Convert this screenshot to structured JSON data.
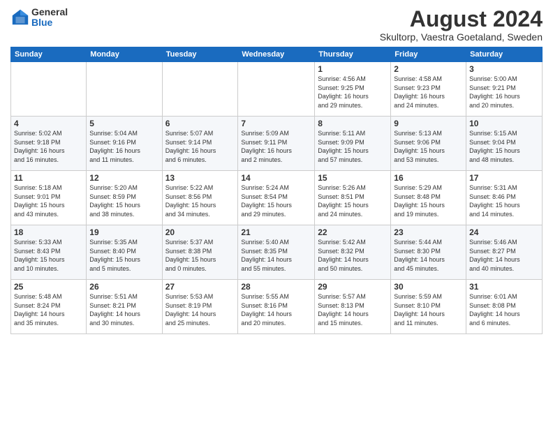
{
  "logo": {
    "general": "General",
    "blue": "Blue"
  },
  "title": {
    "month": "August 2024",
    "location": "Skultorp, Vaestra Goetaland, Sweden"
  },
  "headers": [
    "Sunday",
    "Monday",
    "Tuesday",
    "Wednesday",
    "Thursday",
    "Friday",
    "Saturday"
  ],
  "weeks": [
    [
      {
        "day": "",
        "info": ""
      },
      {
        "day": "",
        "info": ""
      },
      {
        "day": "",
        "info": ""
      },
      {
        "day": "",
        "info": ""
      },
      {
        "day": "1",
        "info": "Sunrise: 4:56 AM\nSunset: 9:25 PM\nDaylight: 16 hours\nand 29 minutes."
      },
      {
        "day": "2",
        "info": "Sunrise: 4:58 AM\nSunset: 9:23 PM\nDaylight: 16 hours\nand 24 minutes."
      },
      {
        "day": "3",
        "info": "Sunrise: 5:00 AM\nSunset: 9:21 PM\nDaylight: 16 hours\nand 20 minutes."
      }
    ],
    [
      {
        "day": "4",
        "info": "Sunrise: 5:02 AM\nSunset: 9:18 PM\nDaylight: 16 hours\nand 16 minutes."
      },
      {
        "day": "5",
        "info": "Sunrise: 5:04 AM\nSunset: 9:16 PM\nDaylight: 16 hours\nand 11 minutes."
      },
      {
        "day": "6",
        "info": "Sunrise: 5:07 AM\nSunset: 9:14 PM\nDaylight: 16 hours\nand 6 minutes."
      },
      {
        "day": "7",
        "info": "Sunrise: 5:09 AM\nSunset: 9:11 PM\nDaylight: 16 hours\nand 2 minutes."
      },
      {
        "day": "8",
        "info": "Sunrise: 5:11 AM\nSunset: 9:09 PM\nDaylight: 15 hours\nand 57 minutes."
      },
      {
        "day": "9",
        "info": "Sunrise: 5:13 AM\nSunset: 9:06 PM\nDaylight: 15 hours\nand 53 minutes."
      },
      {
        "day": "10",
        "info": "Sunrise: 5:15 AM\nSunset: 9:04 PM\nDaylight: 15 hours\nand 48 minutes."
      }
    ],
    [
      {
        "day": "11",
        "info": "Sunrise: 5:18 AM\nSunset: 9:01 PM\nDaylight: 15 hours\nand 43 minutes."
      },
      {
        "day": "12",
        "info": "Sunrise: 5:20 AM\nSunset: 8:59 PM\nDaylight: 15 hours\nand 38 minutes."
      },
      {
        "day": "13",
        "info": "Sunrise: 5:22 AM\nSunset: 8:56 PM\nDaylight: 15 hours\nand 34 minutes."
      },
      {
        "day": "14",
        "info": "Sunrise: 5:24 AM\nSunset: 8:54 PM\nDaylight: 15 hours\nand 29 minutes."
      },
      {
        "day": "15",
        "info": "Sunrise: 5:26 AM\nSunset: 8:51 PM\nDaylight: 15 hours\nand 24 minutes."
      },
      {
        "day": "16",
        "info": "Sunrise: 5:29 AM\nSunset: 8:48 PM\nDaylight: 15 hours\nand 19 minutes."
      },
      {
        "day": "17",
        "info": "Sunrise: 5:31 AM\nSunset: 8:46 PM\nDaylight: 15 hours\nand 14 minutes."
      }
    ],
    [
      {
        "day": "18",
        "info": "Sunrise: 5:33 AM\nSunset: 8:43 PM\nDaylight: 15 hours\nand 10 minutes."
      },
      {
        "day": "19",
        "info": "Sunrise: 5:35 AM\nSunset: 8:40 PM\nDaylight: 15 hours\nand 5 minutes."
      },
      {
        "day": "20",
        "info": "Sunrise: 5:37 AM\nSunset: 8:38 PM\nDaylight: 15 hours\nand 0 minutes."
      },
      {
        "day": "21",
        "info": "Sunrise: 5:40 AM\nSunset: 8:35 PM\nDaylight: 14 hours\nand 55 minutes."
      },
      {
        "day": "22",
        "info": "Sunrise: 5:42 AM\nSunset: 8:32 PM\nDaylight: 14 hours\nand 50 minutes."
      },
      {
        "day": "23",
        "info": "Sunrise: 5:44 AM\nSunset: 8:30 PM\nDaylight: 14 hours\nand 45 minutes."
      },
      {
        "day": "24",
        "info": "Sunrise: 5:46 AM\nSunset: 8:27 PM\nDaylight: 14 hours\nand 40 minutes."
      }
    ],
    [
      {
        "day": "25",
        "info": "Sunrise: 5:48 AM\nSunset: 8:24 PM\nDaylight: 14 hours\nand 35 minutes."
      },
      {
        "day": "26",
        "info": "Sunrise: 5:51 AM\nSunset: 8:21 PM\nDaylight: 14 hours\nand 30 minutes."
      },
      {
        "day": "27",
        "info": "Sunrise: 5:53 AM\nSunset: 8:19 PM\nDaylight: 14 hours\nand 25 minutes."
      },
      {
        "day": "28",
        "info": "Sunrise: 5:55 AM\nSunset: 8:16 PM\nDaylight: 14 hours\nand 20 minutes."
      },
      {
        "day": "29",
        "info": "Sunrise: 5:57 AM\nSunset: 8:13 PM\nDaylight: 14 hours\nand 15 minutes."
      },
      {
        "day": "30",
        "info": "Sunrise: 5:59 AM\nSunset: 8:10 PM\nDaylight: 14 hours\nand 11 minutes."
      },
      {
        "day": "31",
        "info": "Sunrise: 6:01 AM\nSunset: 8:08 PM\nDaylight: 14 hours\nand 6 minutes."
      }
    ]
  ]
}
